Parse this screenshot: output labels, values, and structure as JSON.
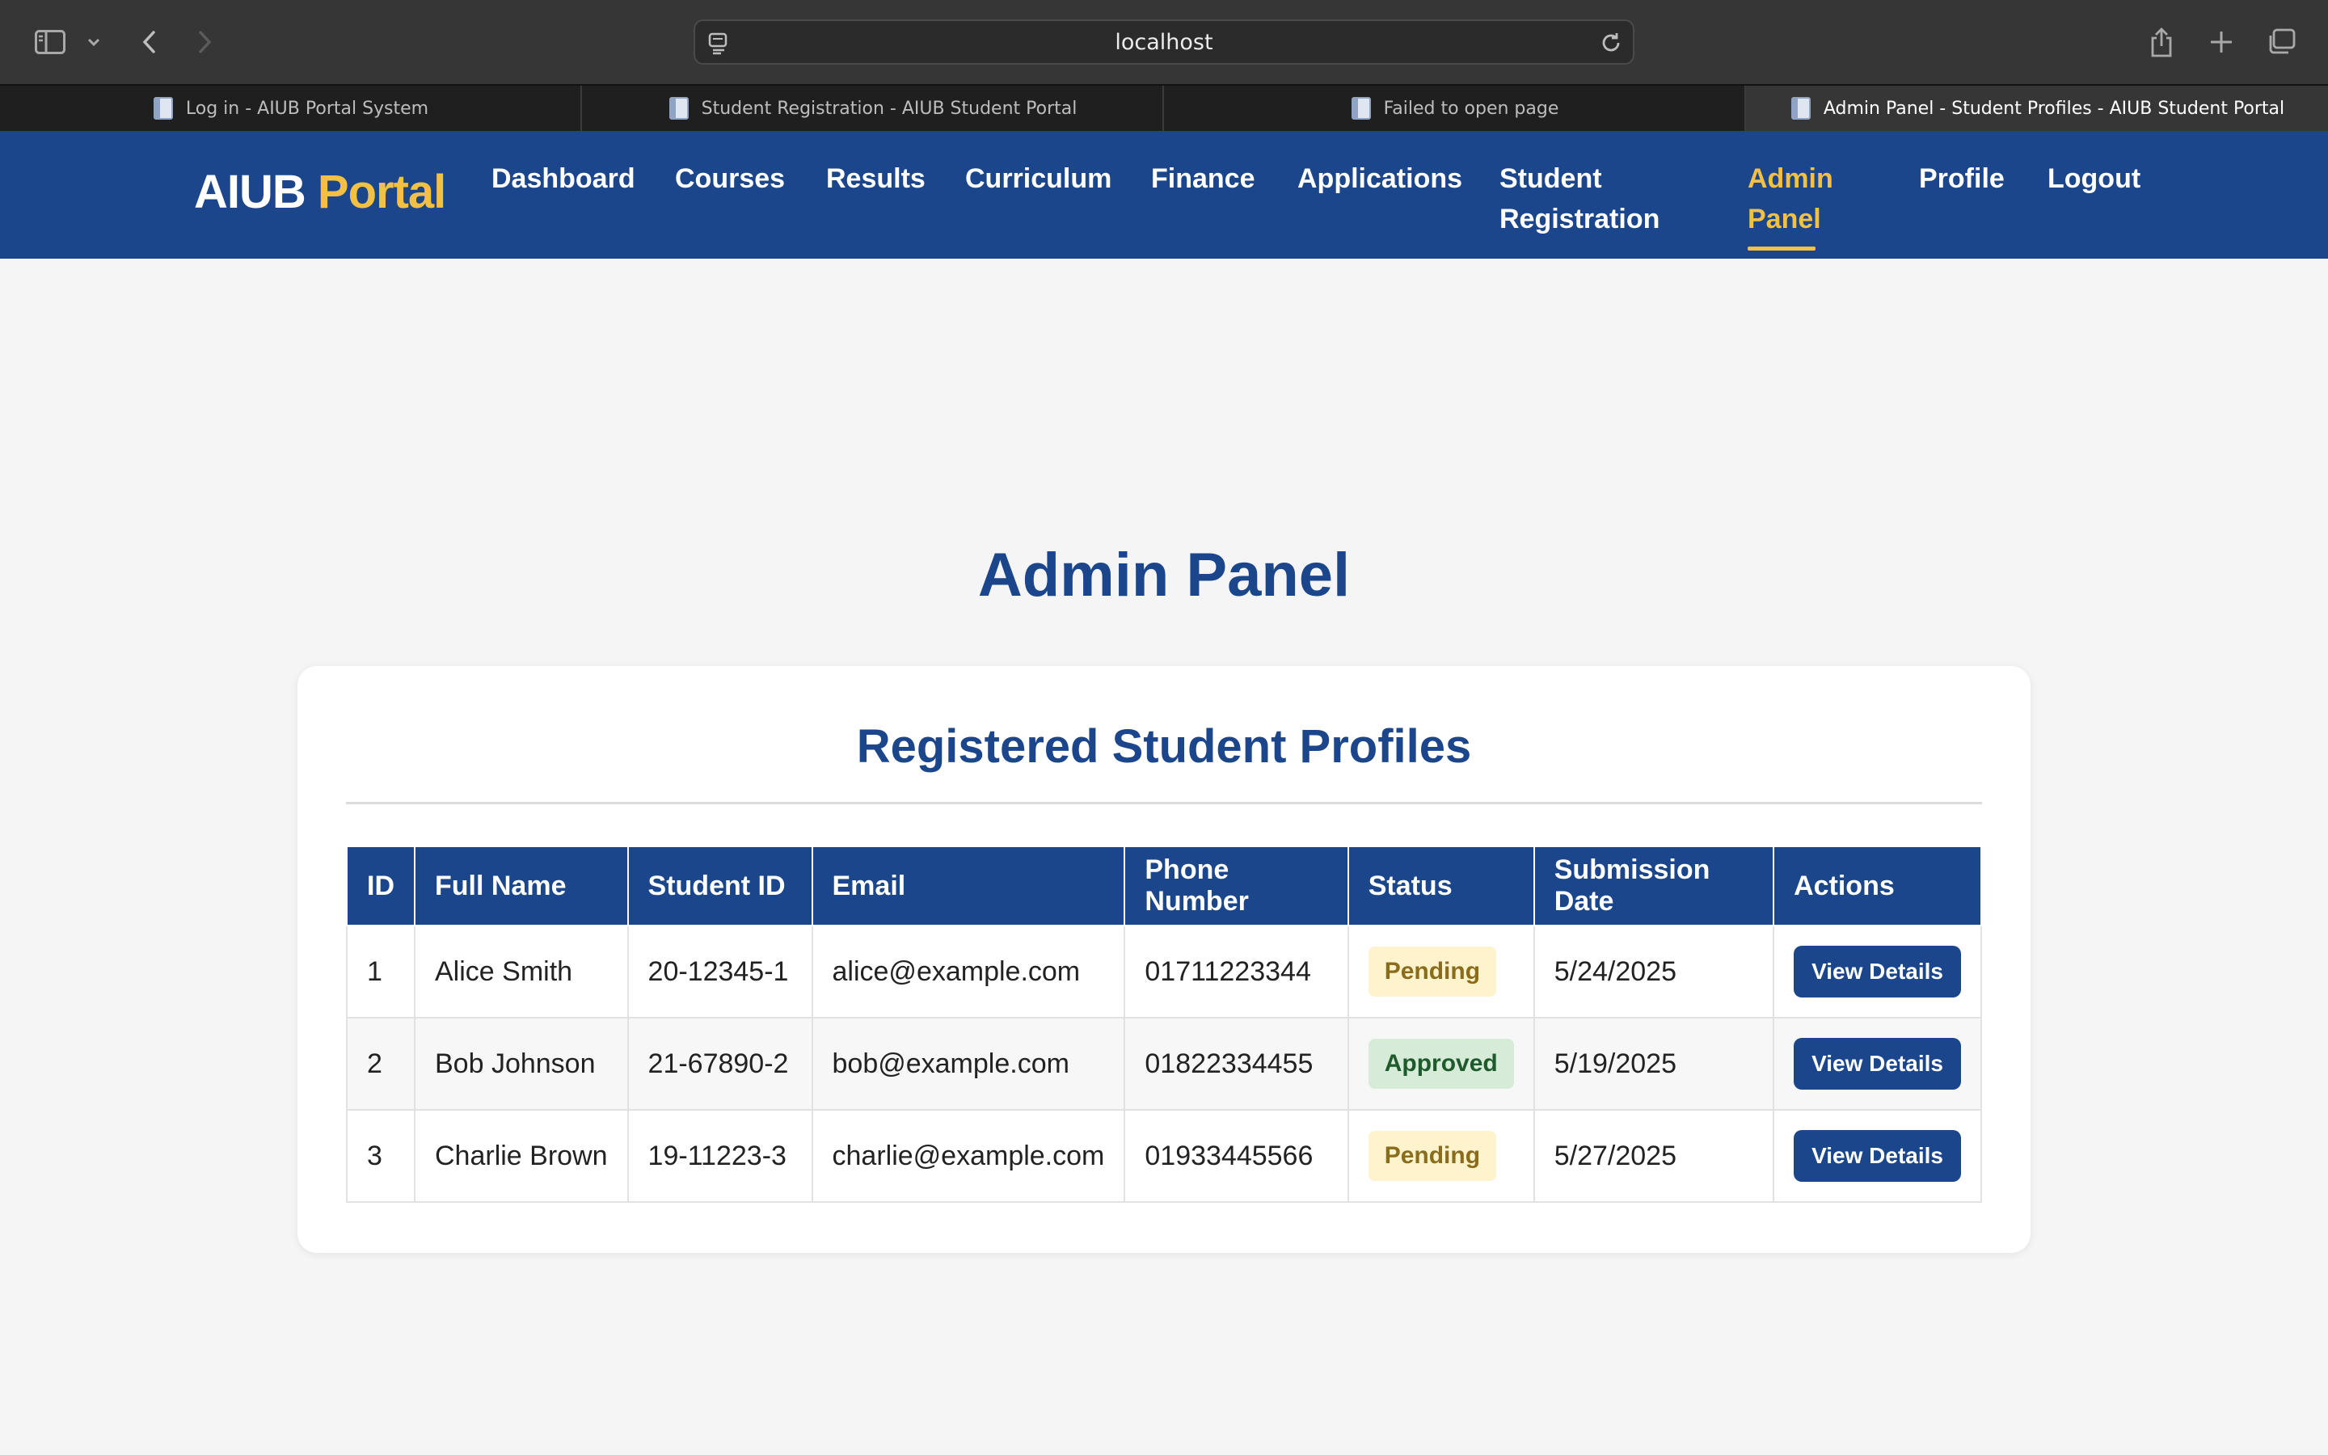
{
  "browser": {
    "url": "localhost",
    "tabs": [
      {
        "title": "Log in - AIUB Portal System"
      },
      {
        "title": "Student Registration - AIUB Student Portal"
      },
      {
        "title": "Failed to open page"
      },
      {
        "title": "Admin Panel - Student Profiles - AIUB Student Portal"
      }
    ],
    "active_tab": 3
  },
  "brand": {
    "primary": "AIUB",
    "accent": "Portal"
  },
  "nav": {
    "items": [
      {
        "label": "Dashboard"
      },
      {
        "label": "Courses"
      },
      {
        "label": "Results"
      },
      {
        "label": "Curriculum"
      },
      {
        "label": "Finance"
      },
      {
        "label": "Applications"
      },
      {
        "label": "Student Registration"
      },
      {
        "label": "Admin Panel"
      },
      {
        "label": "Profile"
      },
      {
        "label": "Logout"
      }
    ],
    "active": "Admin Panel"
  },
  "main": {
    "title": "Admin Panel",
    "card_title": "Registered Student Profiles",
    "table": {
      "headers": [
        "ID",
        "Full Name",
        "Student ID",
        "Email",
        "Phone Number",
        "Status",
        "Submission Date",
        "Actions"
      ],
      "rows": [
        {
          "id": "1",
          "name": "Alice Smith",
          "student_id": "20-12345-1",
          "email": "alice@example.com",
          "phone": "01711223344",
          "status": "Pending",
          "date": "5/24/2025",
          "action": "View Details"
        },
        {
          "id": "2",
          "name": "Bob Johnson",
          "student_id": "21-67890-2",
          "email": "bob@example.com",
          "phone": "01822334455",
          "status": "Approved",
          "date": "5/19/2025",
          "action": "View Details"
        },
        {
          "id": "3",
          "name": "Charlie Brown",
          "student_id": "19-11223-3",
          "email": "charlie@example.com",
          "phone": "01933445566",
          "status": "Pending",
          "date": "5/27/2025",
          "action": "View Details"
        }
      ]
    }
  },
  "colors": {
    "brand_blue": "#1b468b",
    "accent_gold": "#f2c144",
    "pending_bg": "#fff3cd",
    "approved_bg": "#d6ecd9"
  },
  "icons": [
    "sidebar-icon",
    "chevron-down-icon",
    "back-icon",
    "forward-icon",
    "site-icon",
    "reload-icon",
    "share-icon",
    "new-tab-icon",
    "tab-overview-icon",
    "page-icon"
  ]
}
